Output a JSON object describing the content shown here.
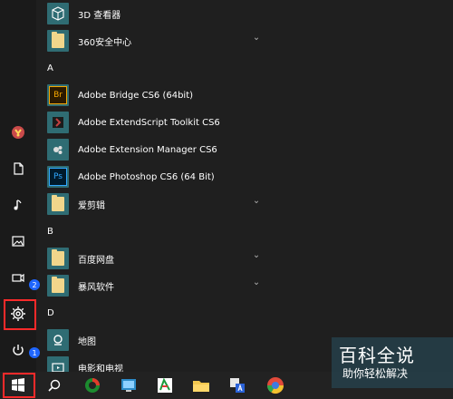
{
  "apps": {
    "items": [
      {
        "label": "3D 查看器",
        "kind": "app",
        "icon": "3d-viewer-icon"
      },
      {
        "label": "360安全中心",
        "kind": "folder",
        "icon": "folder-icon"
      },
      {
        "letter": "A"
      },
      {
        "label": "Adobe Bridge CS6 (64bit)",
        "kind": "app",
        "icon": "adobe-bridge-icon"
      },
      {
        "label": "Adobe ExtendScript Toolkit CS6",
        "kind": "app",
        "icon": "adobe-extendscript-icon"
      },
      {
        "label": "Adobe Extension Manager CS6",
        "kind": "app",
        "icon": "adobe-extension-manager-icon"
      },
      {
        "label": "Adobe Photoshop CS6 (64 Bit)",
        "kind": "app",
        "icon": "adobe-photoshop-icon"
      },
      {
        "label": "爱剪辑",
        "kind": "folder",
        "icon": "folder-icon"
      },
      {
        "letter": "B"
      },
      {
        "label": "百度网盘",
        "kind": "folder",
        "icon": "folder-icon"
      },
      {
        "label": "暴风软件",
        "kind": "folder",
        "icon": "folder-icon"
      },
      {
        "letter": "D"
      },
      {
        "label": "地图",
        "kind": "app",
        "icon": "maps-icon"
      },
      {
        "label": "电影和电视",
        "kind": "app",
        "icon": "movies-tv-icon"
      }
    ]
  },
  "rail": {
    "items": [
      {
        "icon": "user-avatar-icon"
      },
      {
        "icon": "document-icon"
      },
      {
        "icon": "music-icon"
      },
      {
        "icon": "pictures-icon"
      },
      {
        "icon": "videos-icon"
      },
      {
        "icon": "settings-gear-icon"
      },
      {
        "icon": "power-icon"
      }
    ]
  },
  "badges": {
    "b1": "1",
    "b2": "2"
  },
  "taskbar": {
    "items": [
      {
        "icon": "windows-start-icon"
      },
      {
        "icon": "search-icon"
      },
      {
        "icon": "app-1-icon"
      },
      {
        "icon": "app-2-icon"
      },
      {
        "icon": "app-3-icon"
      },
      {
        "icon": "file-explorer-icon"
      },
      {
        "icon": "translator-icon"
      },
      {
        "icon": "chrome-icon"
      }
    ]
  },
  "watermark": {
    "title": "百科全说",
    "subtitle": "助你轻松解决"
  },
  "colors": {
    "accent": "#1f66ff",
    "highlight": "#ff2a2a",
    "tile": "#2f6c73",
    "folder": "#f1d68b"
  }
}
